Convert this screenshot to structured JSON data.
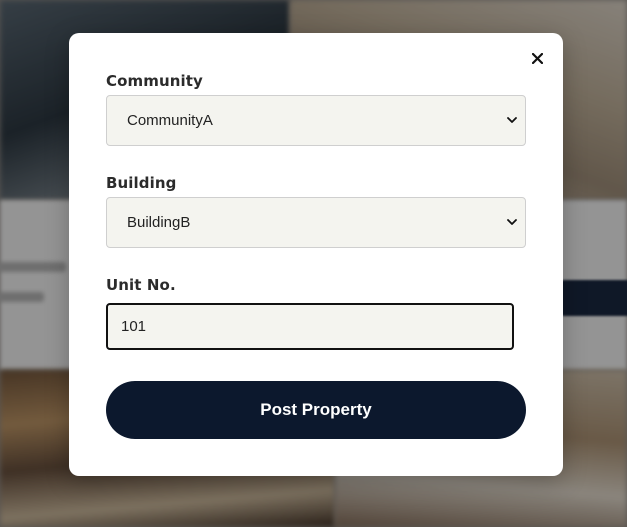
{
  "form": {
    "community": {
      "label": "Community",
      "value": "CommunityA"
    },
    "building": {
      "label": "Building",
      "value": "BuildingB"
    },
    "unit": {
      "label": "Unit No.",
      "value": "101"
    },
    "submit_label": "Post Property"
  },
  "icons": {
    "close": "close-icon",
    "dropdown": "chevron-down-icon"
  },
  "colors": {
    "primary_button": "#0c182d",
    "field_background": "#f4f4ef",
    "modal_background": "#ffffff"
  }
}
